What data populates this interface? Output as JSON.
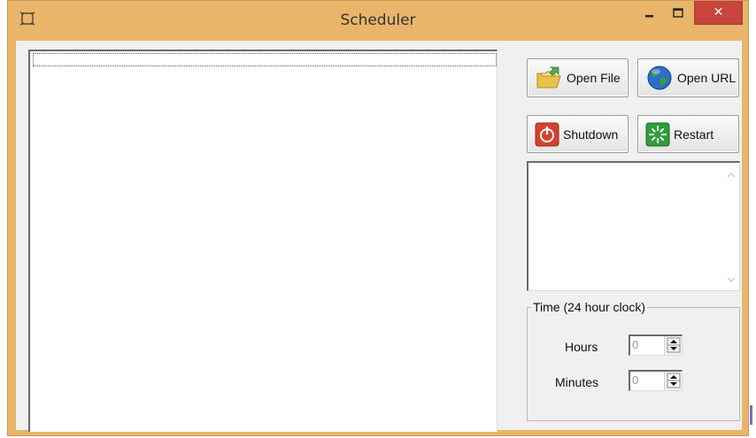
{
  "window": {
    "title": "Scheduler",
    "close_glyph": "✕"
  },
  "buttons": {
    "open_file": {
      "label": "Open File",
      "icon": "folder-icon"
    },
    "open_url": {
      "label": "Open URL",
      "icon": "globe-icon"
    },
    "shutdown": {
      "label": "Shutdown",
      "icon": "power-icon"
    },
    "restart": {
      "label": "Restart",
      "icon": "restart-icon"
    }
  },
  "time_group": {
    "title": "Time (24 hour clock)",
    "hours": {
      "label": "Hours",
      "value": "0"
    },
    "minutes": {
      "label": "Minutes",
      "value": "0"
    }
  },
  "colors": {
    "titlebar": "#e9b56a",
    "close_button": "#c7453b",
    "client_bg": "#f0f0f0"
  }
}
